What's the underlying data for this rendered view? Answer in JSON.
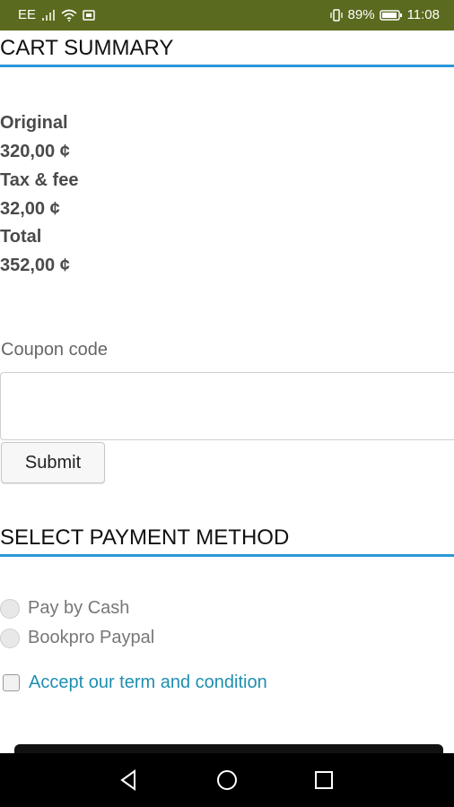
{
  "status_bar": {
    "carrier": "EE",
    "battery_percent": "89%",
    "time": "11:08",
    "icons": [
      "signal-icon",
      "wifi-icon",
      "sim-icon",
      "vibrate-icon",
      "battery-icon"
    ]
  },
  "cart_summary": {
    "heading": "CART SUMMARY",
    "original_label": "Original",
    "original_value": "320,00 ¢",
    "tax_label": "Tax & fee",
    "tax_value": "32,00 ¢",
    "total_label": "Total",
    "total_value": "352,00 ¢"
  },
  "coupon": {
    "label": "Coupon code",
    "value": "",
    "submit_label": "Submit"
  },
  "payment": {
    "heading": "SELECT PAYMENT METHOD",
    "options": [
      "Pay by Cash",
      "Bookpro Paypal"
    ],
    "terms_label": "Accept our term and condition"
  },
  "nav": {
    "icons": [
      "back-icon",
      "home-icon",
      "recents-icon"
    ]
  },
  "colors": {
    "status_bar": "#5a6a1e",
    "accent": "#2a97d8",
    "link": "#1f8fb0"
  }
}
